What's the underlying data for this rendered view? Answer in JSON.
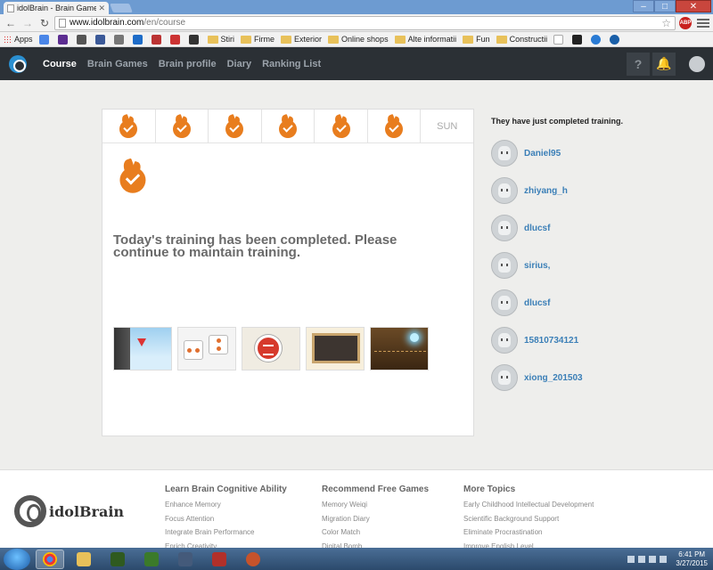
{
  "browser": {
    "tab_title": "idolBrain - Brain Games &",
    "url_host": "www.idolbrain.com",
    "url_path": "/en/course",
    "bookmarks": [
      "Apps",
      "Stiri",
      "Firme",
      "Exterior",
      "Online shops",
      "Alte informatii",
      "Fun",
      "Constructii"
    ]
  },
  "nav": {
    "items": [
      "Course",
      "Brain Games",
      "Brain profile",
      "Diary",
      "Ranking List"
    ],
    "help_icon": "?"
  },
  "course": {
    "last_day": "SUN",
    "message": "Today's training has been completed. Please continue to maintain training."
  },
  "side": {
    "title": "They have just completed training.",
    "users": [
      "Daniel95",
      "zhiyang_h",
      "dlucsf",
      "sirius,",
      "dlucsf",
      "15810734121",
      "xiong_201503"
    ]
  },
  "footer": {
    "logo": "idolBrain",
    "columns": [
      {
        "title": "Learn Brain Cognitive Ability",
        "links": [
          "Enhance Memory",
          "Focus Attention",
          "Integrate Brain Performance",
          "Enrich Creativity"
        ]
      },
      {
        "title": "Recommend Free Games",
        "links": [
          "Memory Weiqi",
          "Migration Diary",
          "Color Match",
          "Digital Bomb"
        ]
      },
      {
        "title": "More Topics",
        "links": [
          "Early Childhood Intellectual Development",
          "Scientific Background Support",
          "Eliminate Procrastination",
          "Improve English Level"
        ]
      }
    ]
  },
  "taskbar": {
    "time": "6:41 PM",
    "date": "3/27/2015"
  }
}
